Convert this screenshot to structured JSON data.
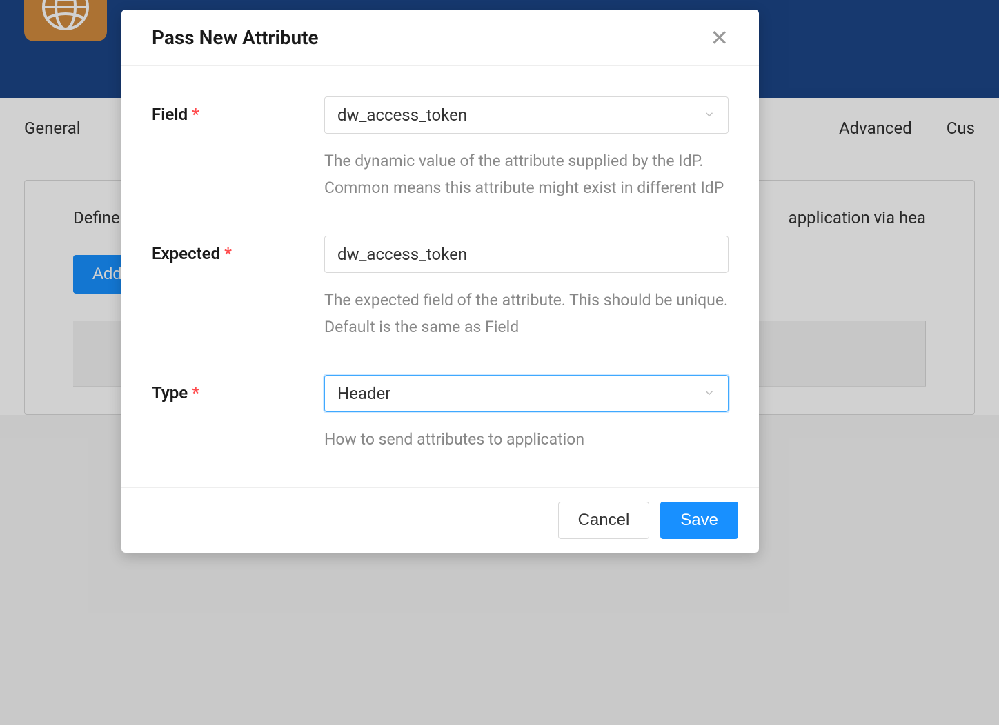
{
  "background": {
    "tabs": {
      "left": "General",
      "right1": "Advanced",
      "right2": "Cus"
    },
    "panel": {
      "text_prefix": "Define",
      "text_suffix": "application via hea",
      "add_button": "Add"
    }
  },
  "modal": {
    "title": "Pass New Attribute",
    "fields": {
      "field": {
        "label": "Field",
        "value": "dw_access_token",
        "help": "The dynamic value of the attribute supplied by the IdP. Common means this attribute might exist in different IdP"
      },
      "expected": {
        "label": "Expected",
        "value": "dw_access_token",
        "help": "The expected field of the attribute. This should be unique. Default is the same as Field"
      },
      "type": {
        "label": "Type",
        "value": "Header",
        "help": "How to send attributes to application"
      }
    },
    "buttons": {
      "cancel": "Cancel",
      "save": "Save"
    }
  }
}
